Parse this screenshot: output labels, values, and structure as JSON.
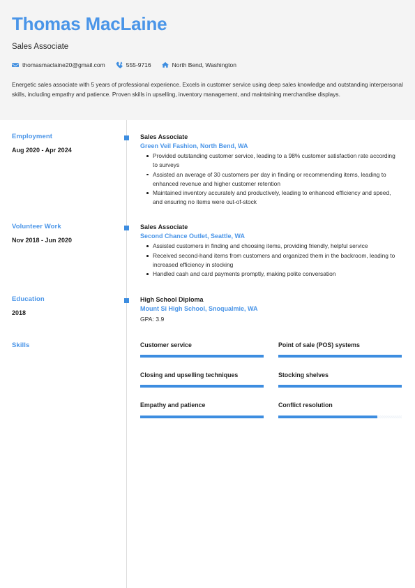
{
  "theme": {
    "accent": "#4a95e8",
    "bar_fill": "#3d8de0",
    "header_bg": "#f4f4f4",
    "text": "#2d2d2d"
  },
  "header": {
    "name": "Thomas MacLaine",
    "job_title": "Sales Associate",
    "contacts": [
      {
        "icon": "envelope-icon",
        "value": "thomasmaclaine20@gmail.com"
      },
      {
        "icon": "phone-icon",
        "value": "555-9716"
      },
      {
        "icon": "home-icon",
        "value": "North Bend, Washington"
      }
    ],
    "summary": "Energetic sales associate with 5 years of professional experience. Excels in customer service using deep sales knowledge and outstanding interpersonal skills, including empathy and patience. Proven skills in upselling, inventory management, and maintaining merchandise displays."
  },
  "sections": {
    "employment": {
      "heading": "Employment",
      "date_range": "Aug 2020 - Apr 2024",
      "title": "Sales Associate",
      "org": "Green Veil Fashion, North Bend, WA",
      "bullets": [
        "Provided outstanding customer service, leading to a 98% customer satisfaction rate according to surveys",
        "Assisted an average of 30 customers per day in finding or recommending items, leading to enhanced revenue and higher customer retention",
        "Maintained inventory accurately and productively, leading to enhanced efficiency and speed, and ensuring no items were out-of-stock"
      ]
    },
    "volunteer": {
      "heading": "Volunteer Work",
      "date_range": "Nov 2018 - Jun 2020",
      "title": "Sales Associate",
      "org": "Second Chance Outlet, Seattle, WA",
      "bullets": [
        "Assisted customers in finding and choosing items, providing friendly, helpful service",
        "Received second-hand items from customers and organized them in the backroom, leading to increased efficiency in stocking",
        "Handled cash and card payments promptly, making polite conversation"
      ]
    },
    "education": {
      "heading": "Education",
      "date_range": "2018",
      "title": "High School Diploma",
      "org": "Mount Si High School, Snoqualmie, WA",
      "gpa": "GPA: 3.9"
    },
    "skills": {
      "heading": "Skills",
      "items": [
        {
          "label": "Customer service",
          "level": 100
        },
        {
          "label": "Point of sale (POS) systems",
          "level": 100
        },
        {
          "label": "Closing and upselling techniques",
          "level": 100
        },
        {
          "label": "Stocking shelves",
          "level": 100
        },
        {
          "label": "Empathy and patience",
          "level": 100
        },
        {
          "label": "Conflict resolution",
          "level": 80
        }
      ]
    }
  }
}
